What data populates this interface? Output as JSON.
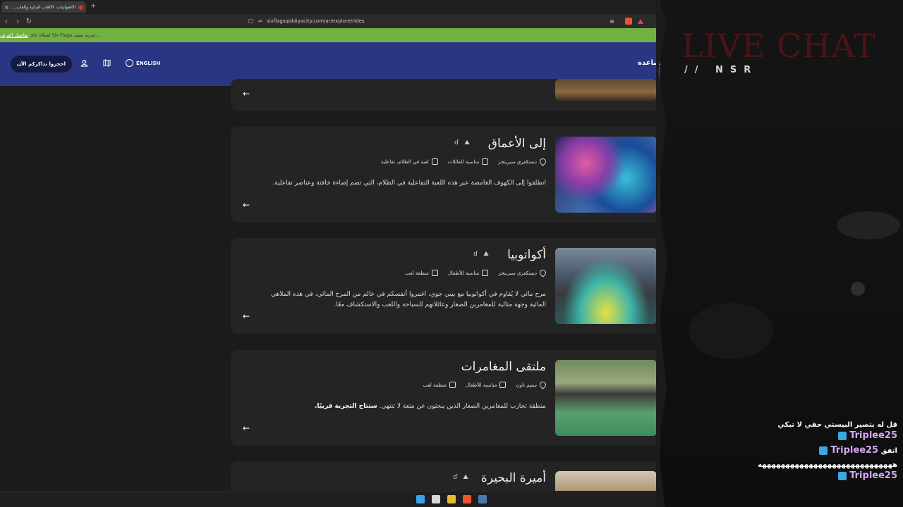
{
  "browser": {
    "tab_title": "الأفعوانيات، الألعاب المائية وألعاب...",
    "tab_close": "×",
    "new_tab": "+",
    "nav_back": "‹",
    "nav_forward": "›",
    "nav_reload": "↻",
    "bookmark": "☐",
    "zoom": "⊕",
    "url": "sixflagsqiddiyacity.com/ar/explore/rides"
  },
  "announcement": {
    "text": "...تجربة صيف Six Flags لعملاء stc",
    "link": "تفاصيل العرض"
  },
  "site_nav": {
    "book_button": "احجزوا تذاكركم الآن",
    "language": "ENGLISH",
    "help": "مساعدة"
  },
  "rides": [
    {
      "title": "إلى الأعماق",
      "location": "ديسكفري سبرينجز",
      "audience": "مناسبة للعائلات",
      "category": "لعبة في الظلام، تفاعلية",
      "description": "انطلقوا إلى الكهوف الغامضة عبر هذه اللعبة التفاعلية في الظلام، التي تضم إضاءة خافتة وعناصر تفاعلية.",
      "description_bold": ""
    },
    {
      "title": "أكواتوبيا",
      "location": "ديسكفري سبرينجز",
      "audience": "مناسبة للأطفال",
      "category": "منطقة لعب",
      "description": "مرح مائي لا يُقاوم في أكواتوبيا مع بيبي جوي، اغمروا أنفسكم في عالم من المرح المائي، في هذه الملاهي المائية وجهة مثالية للمغامرين الصغار وعائلاتهم للسباحة واللعب والاستكشاف معًا.",
      "description_bold": ""
    },
    {
      "title": "ملتقى المغامرات",
      "location": "ستيم تاون",
      "audience": "مناسبة للأطفال",
      "category": "منطقة لعب",
      "description": "منطقة تجارب للمغامرين الصغار الذين يبحثون عن متعة لا تنتهي.",
      "description_bold": "ستتاح التجربة قريبًا."
    },
    {
      "title": "أميرة البحيرة",
      "location": "",
      "audience": "",
      "category": "",
      "description": "",
      "description_bold": ""
    }
  ],
  "arrow_glyph": "←",
  "overlay": {
    "title": "LIVE CHAT",
    "subtitle": "// NSR"
  },
  "chat": [
    {
      "user": "Triplee25",
      "text": "قل له بتصير البيستي حقي لا تبكي"
    },
    {
      "user": "Triplee25",
      "text": "اتفق"
    },
    {
      "user": "Triplee25",
      "text": "هههههههههههههههههههههههههههههه"
    }
  ],
  "colors": {
    "nav": "#2a3583",
    "announce": "#72b043",
    "card": "#242424",
    "live_chat_title": "#4a1416",
    "chat_user": "#d9a6f5"
  }
}
